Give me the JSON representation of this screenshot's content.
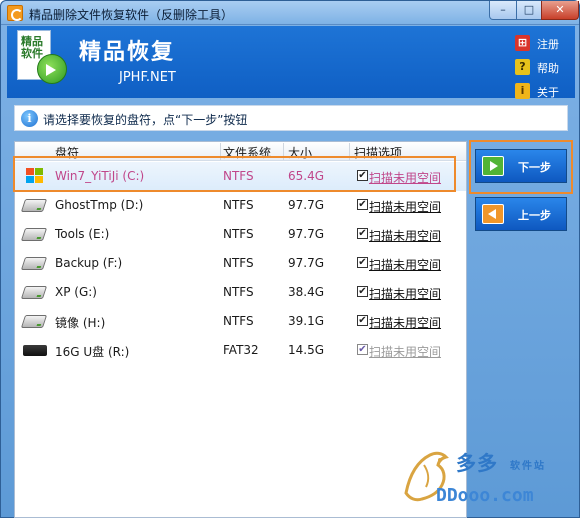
{
  "window": {
    "title": "精品删除文件恢复软件（反删除工具）",
    "controls": {
      "minimize": "–",
      "maximize": "□",
      "close": "✕"
    }
  },
  "header": {
    "logo_text": "精品软件",
    "app_name": "精品恢复",
    "url": "JPHF.NET",
    "links": [
      {
        "label": "注册",
        "icon": "register-icon"
      },
      {
        "label": "帮助",
        "icon": "help-icon"
      },
      {
        "label": "关于",
        "icon": "about-icon"
      }
    ]
  },
  "tip": {
    "icon": "i",
    "text": "请选择要恢复的盘符，点“下一步”按钮"
  },
  "table": {
    "columns": [
      "盘符",
      "文件系统",
      "大小",
      "扫描选项"
    ],
    "rows": [
      {
        "drive": "Win7_YiTiJi (C:)",
        "fs": "NTFS",
        "size": "65.4G",
        "option": "扫描未用空间",
        "checked": true,
        "selected": true,
        "icon": "windows-drive-icon"
      },
      {
        "drive": "GhostTmp (D:)",
        "fs": "NTFS",
        "size": "97.7G",
        "option": "扫描未用空间",
        "checked": true,
        "icon": "hard-drive-icon"
      },
      {
        "drive": "Tools (E:)",
        "fs": "NTFS",
        "size": "97.7G",
        "option": "扫描未用空间",
        "checked": true,
        "icon": "hard-drive-icon"
      },
      {
        "drive": "Backup (F:)",
        "fs": "NTFS",
        "size": "97.7G",
        "option": "扫描未用空间",
        "checked": true,
        "icon": "hard-drive-icon"
      },
      {
        "drive": "XP (G:)",
        "fs": "NTFS",
        "size": "38.4G",
        "option": "扫描未用空间",
        "checked": true,
        "icon": "hard-drive-icon"
      },
      {
        "drive": "镜像 (H:)",
        "fs": "NTFS",
        "size": "39.1G",
        "option": "扫描未用空间",
        "checked": true,
        "icon": "hard-drive-icon"
      },
      {
        "drive": "16G U盘 (R:)",
        "fs": "FAT32",
        "size": "14.5G",
        "option": "扫描未用空间",
        "checked": true,
        "disabled": true,
        "icon": "usb-drive-icon"
      }
    ]
  },
  "buttons": {
    "next": "下一步",
    "prev": "上一步"
  },
  "watermark": {
    "cn": "多多",
    "sub": "软件站",
    "domain": "DDooo.com"
  },
  "colors": {
    "accent": "#0f5fc4",
    "highlight": "#ee8a2c",
    "selected_text": "#c0468a"
  }
}
